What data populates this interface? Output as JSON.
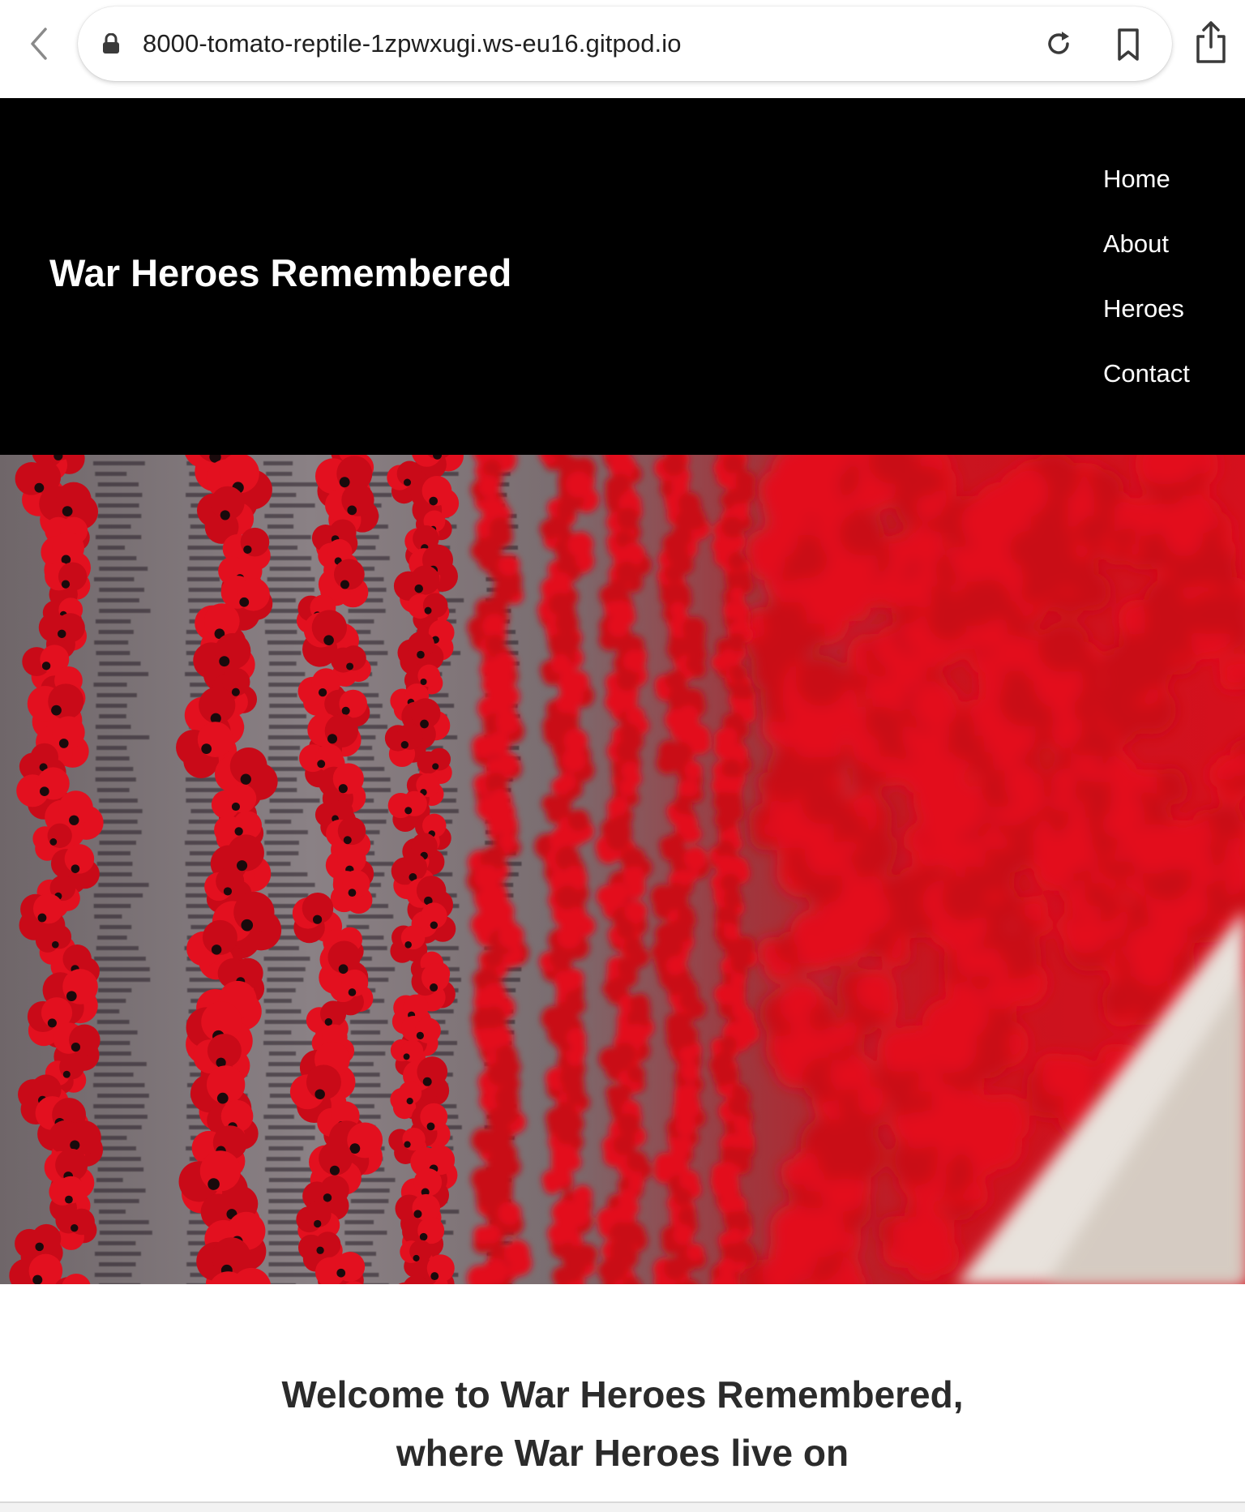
{
  "browser": {
    "url": "8000-tomato-reptile-1zpwxugi.ws-eu16.gitpod.io"
  },
  "site": {
    "title": "War Heroes Remembered",
    "nav": [
      {
        "label": "Home"
      },
      {
        "label": "About"
      },
      {
        "label": "Heroes"
      },
      {
        "label": "Contact"
      }
    ]
  },
  "main": {
    "welcome_line1": "Welcome to War Heroes Remembered,",
    "welcome_line2": "where War Heroes live on"
  },
  "colors": {
    "header_bg": "#000000",
    "poppy_red": "#e01020",
    "wall_grey": "#7d7478"
  }
}
